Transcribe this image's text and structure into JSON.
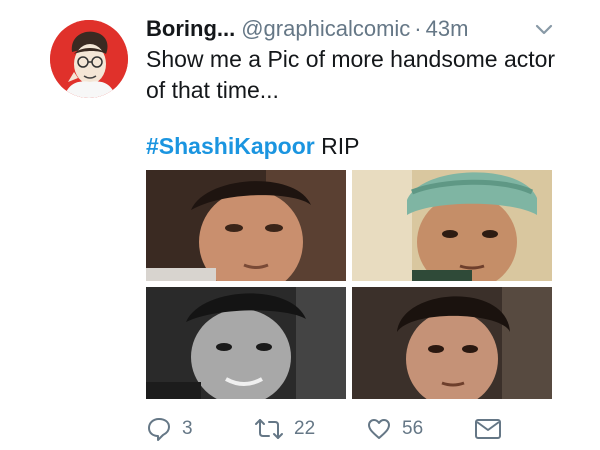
{
  "tweet": {
    "display_name": "Boring...",
    "handle": "@graphicalcomic",
    "separator": "·",
    "time": "43m",
    "text": "Show me a Pic of more handsome actor of that time...",
    "hashtag": "#ShashiKapoor",
    "after_hashtag": " RIP"
  },
  "icons": {
    "avatar": "cartoon-face-avatar",
    "menu": "chevron-down-icon",
    "reply": "reply-icon",
    "retweet": "retweet-icon",
    "like": "heart-icon",
    "dm": "envelope-icon"
  },
  "actions": {
    "reply_count": "3",
    "retweet_count": "22",
    "like_count": "56"
  },
  "colors": {
    "text": "#14171a",
    "muted": "#657786",
    "link": "#1b95e0",
    "avatar_bg": "#e0312b"
  }
}
